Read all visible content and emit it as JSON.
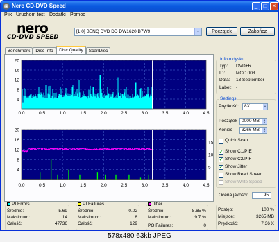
{
  "window": {
    "title": "Nero CD-DVD Speed"
  },
  "menu": [
    "Plik",
    "Uruchom test",
    "Dodatki",
    "Pomoc"
  ],
  "logo": {
    "line1": "nero",
    "line2": "CD·DVD SPEED"
  },
  "drive": {
    "label": "[1:0]  BENQ DVD DD DW1620 B7W9"
  },
  "buttons": {
    "start": "Początek",
    "exit": "Zakończ"
  },
  "tabs": [
    "Benchmark",
    "Disc Info",
    "Disc Quality",
    "ScanDisc"
  ],
  "disc_info": {
    "title": "Info o dysku",
    "rows": [
      {
        "key": "Typ:",
        "value": "DVD+R"
      },
      {
        "key": "ID:",
        "value": "MCC 003"
      },
      {
        "key": "Data:",
        "value": "13 September"
      },
      {
        "key": "Label:",
        "value": "-"
      }
    ]
  },
  "settings": {
    "title": "Settings",
    "speed_label": "Prędkość:",
    "speed_value": "8X",
    "start_label": "Początek",
    "start_value": "0000 MB",
    "end_label": "Koniec",
    "end_value": "3266 MB",
    "checkboxes": [
      {
        "label": "Quick Scan",
        "checked": false,
        "enabled": true
      },
      {
        "label": "Show C1/PIE",
        "checked": true,
        "enabled": true
      },
      {
        "label": "Show C2/PIF",
        "checked": true,
        "enabled": true
      },
      {
        "label": "Show Jitter",
        "checked": true,
        "enabled": true
      },
      {
        "label": "Show Read Speed",
        "checked": false,
        "enabled": true
      },
      {
        "label": "Show Write Speed",
        "checked": false,
        "enabled": false
      }
    ]
  },
  "quality": {
    "label": "Ocena jakości:",
    "value": "95"
  },
  "stats": {
    "pi_errors": {
      "title": "PI Errors",
      "color": "#00ffff",
      "rows": [
        [
          "Średnio:",
          "5.69"
        ],
        [
          "Maksimum:",
          "14"
        ],
        [
          "Całość:",
          "47736"
        ]
      ]
    },
    "pi_failures": {
      "title": "PI Failures",
      "color": "#ffff00",
      "rows": [
        [
          "Średnio:",
          "0.02"
        ],
        [
          "Maksimum:",
          "8"
        ],
        [
          "Całość:",
          "129"
        ]
      ]
    },
    "jitter": {
      "title": "Jitter",
      "color": "#ff00ff",
      "rows": [
        [
          "Średnio:",
          "8.65 %"
        ],
        [
          "Maksimum:",
          "9.7 %"
        ]
      ],
      "po_label": "PO Failures:",
      "po_value": "0"
    }
  },
  "progress": {
    "rows": [
      [
        "Postęp:",
        "100 %"
      ],
      [
        "Miejsce:",
        "3265 MB"
      ],
      [
        "Prędkość:",
        "7.36 X"
      ]
    ]
  },
  "footer": {
    "text": "578x480  63kb  JPEG"
  },
  "chart_data": [
    {
      "type": "bar",
      "title": "",
      "series": [
        {
          "name": "PI Errors",
          "color": "#00ffff"
        }
      ],
      "xlim": [
        0,
        4.5
      ],
      "ylim": [
        0,
        20
      ],
      "xticks": [
        "0.0",
        "0.5",
        "1.0",
        "1.5",
        "2.0",
        "2.5",
        "3.0",
        "3.5",
        "4.0",
        "4.5"
      ],
      "yticks": [
        "20",
        "16",
        "12",
        "8",
        "4"
      ],
      "data_end": 3.19,
      "typical": 5.7,
      "max": 14,
      "peaks": [
        [
          0.1,
          8
        ],
        [
          0.42,
          9
        ],
        [
          0.6,
          10
        ],
        [
          0.95,
          9
        ],
        [
          1.25,
          10
        ],
        [
          1.4,
          12
        ],
        [
          1.75,
          9
        ],
        [
          1.92,
          14
        ],
        [
          2.1,
          9
        ],
        [
          2.35,
          13
        ],
        [
          2.55,
          9
        ],
        [
          2.78,
          11
        ],
        [
          3.08,
          9
        ]
      ]
    },
    {
      "type": "bar",
      "title": "",
      "series": [
        {
          "name": "PI Failures",
          "color": "#00ff00"
        },
        {
          "name": "Jitter",
          "color": "#ff00ff"
        }
      ],
      "xlim": [
        0,
        4.5
      ],
      "ylim": [
        0,
        20
      ],
      "xticks": [
        "0.0",
        "0.5",
        "1.0",
        "1.5",
        "2.0",
        "2.5",
        "3.0",
        "3.5",
        "4.0",
        "4.5"
      ],
      "yticks": [
        "20",
        "16",
        "12",
        "8",
        "4"
      ],
      "yticks_right": [
        "15",
        "10",
        "5"
      ],
      "data_end": 3.19,
      "jitter_level_pct": 9.2,
      "pif_bars": [
        [
          0.45,
          3
        ],
        [
          0.72,
          8
        ],
        [
          0.88,
          2
        ],
        [
          1.15,
          4
        ],
        [
          1.42,
          2
        ],
        [
          1.85,
          3
        ],
        [
          2.05,
          2
        ],
        [
          2.3,
          2
        ],
        [
          2.62,
          2
        ],
        [
          2.9,
          1
        ],
        [
          3.1,
          2
        ]
      ]
    }
  ]
}
